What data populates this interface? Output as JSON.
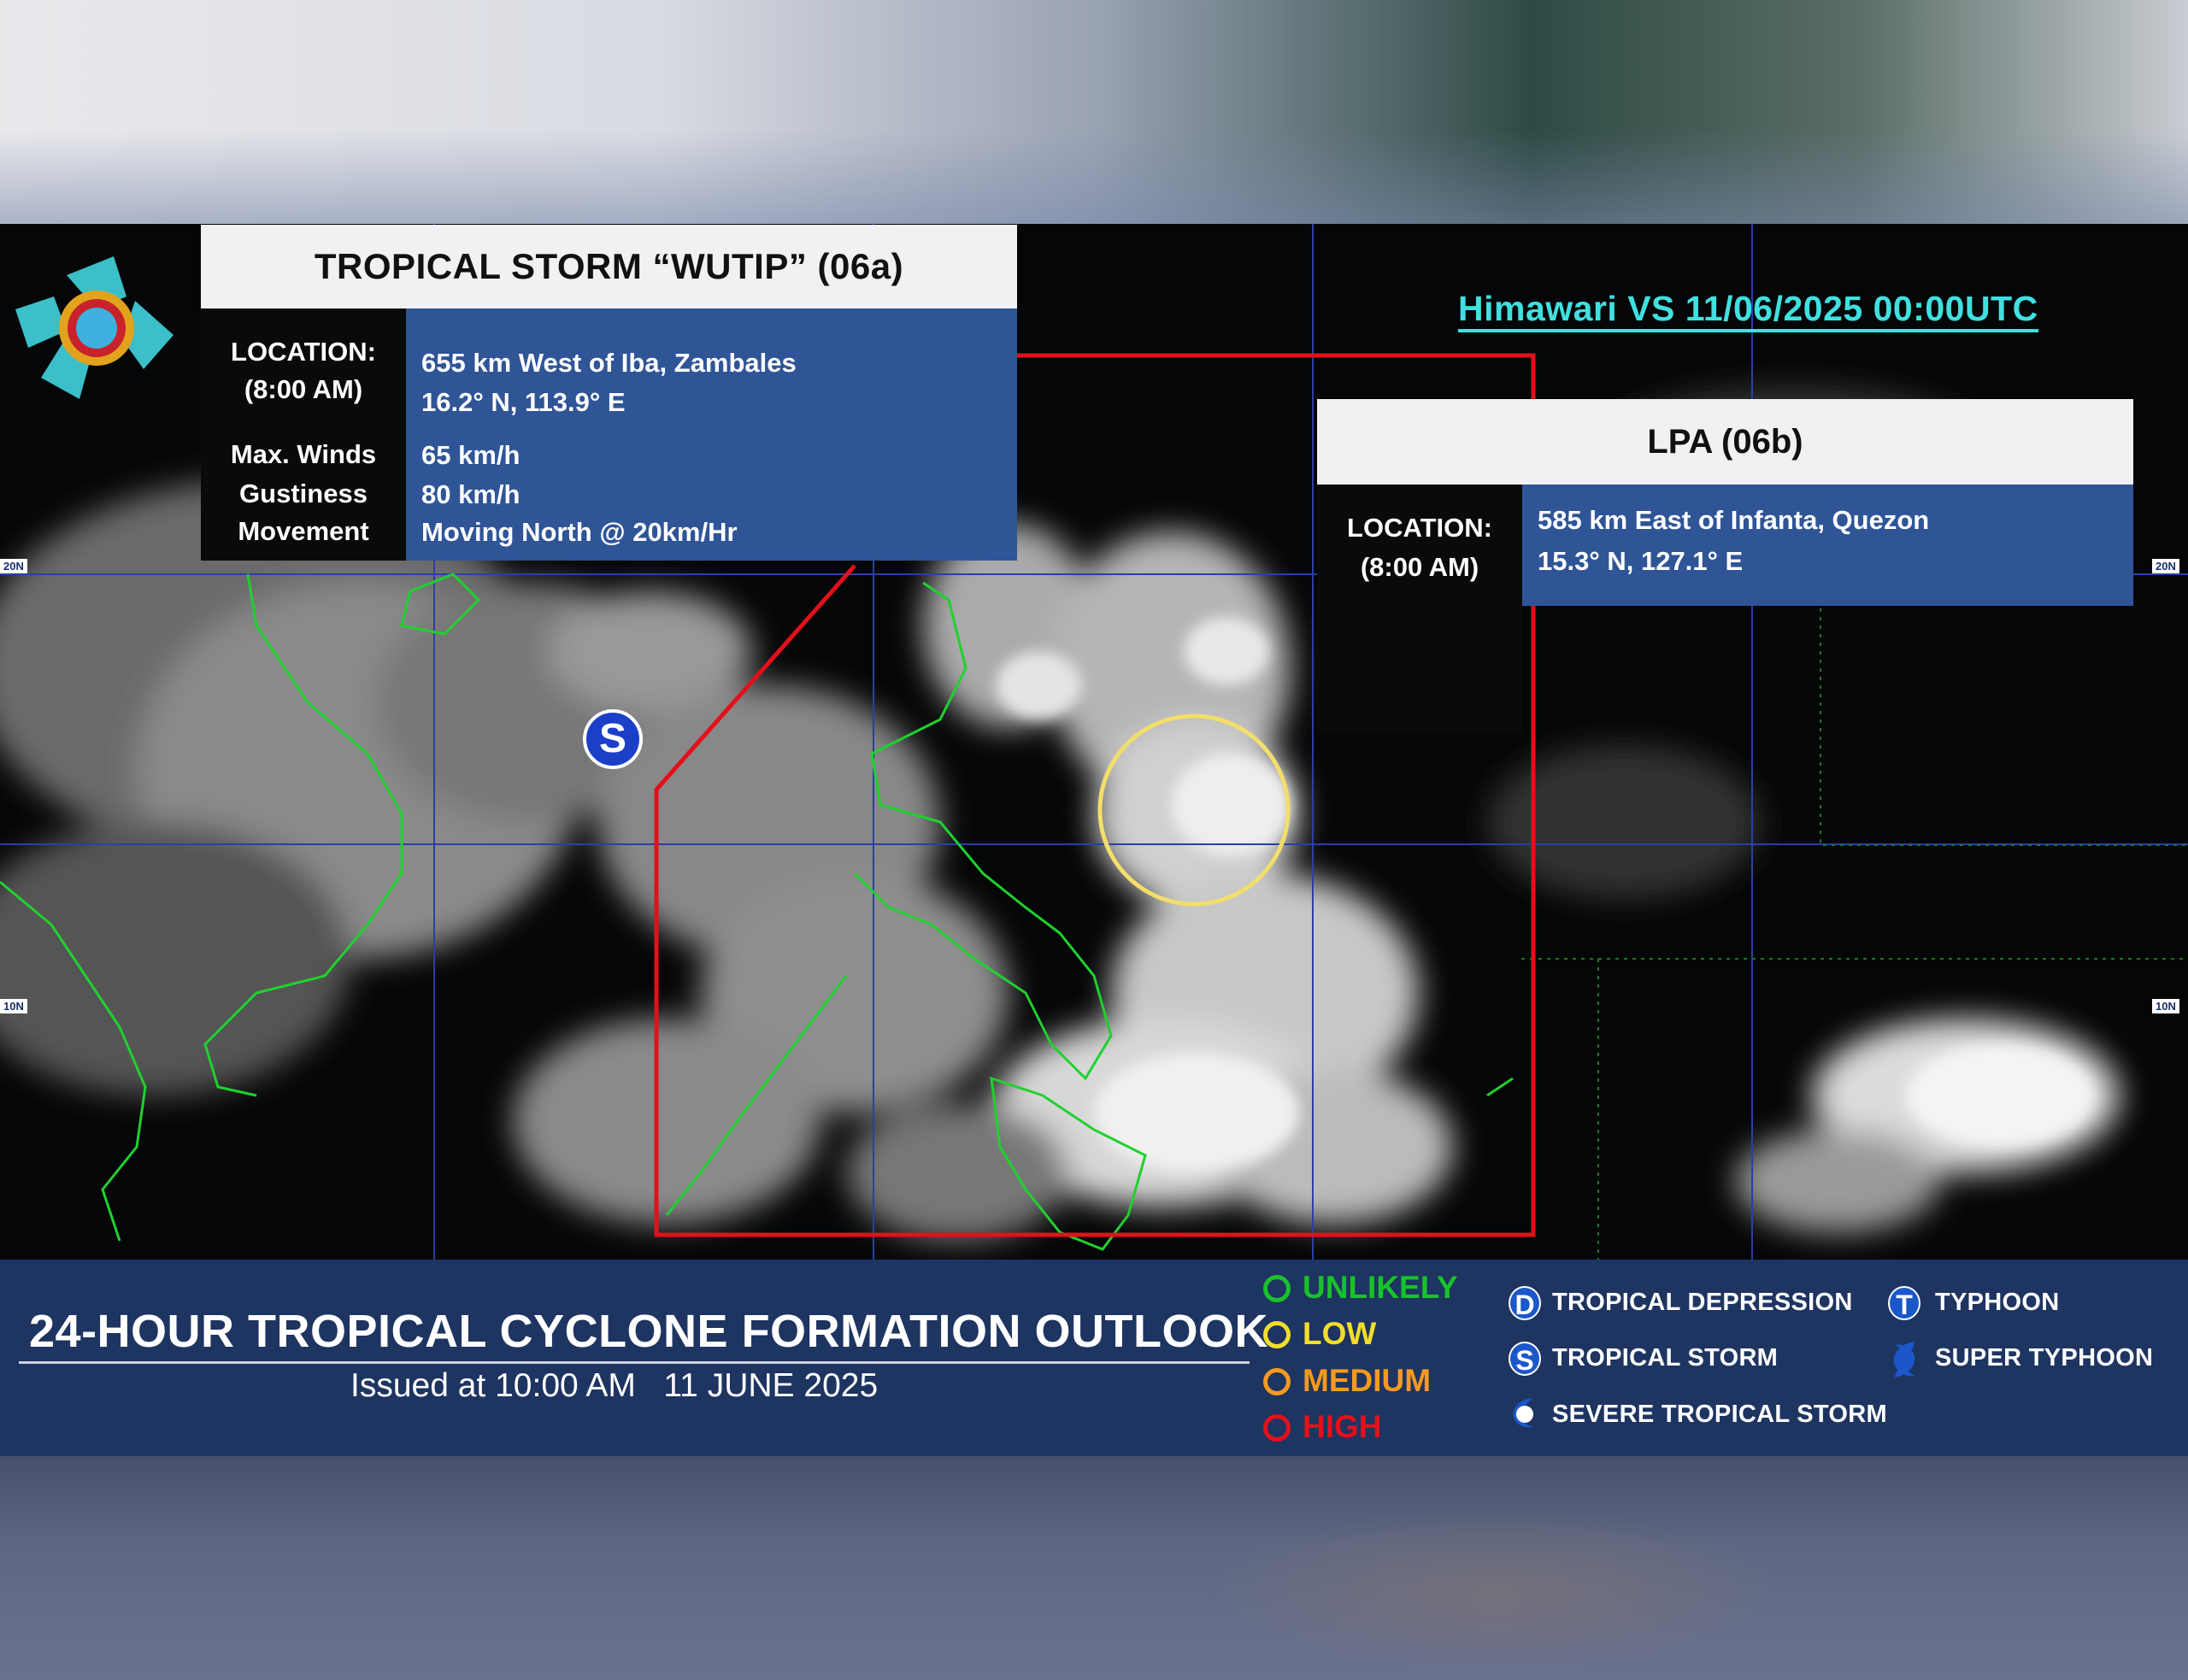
{
  "storm": {
    "title": "TROPICAL STORM “WUTIP” (06a)",
    "location_label": "LOCATION:",
    "time_label": "(8:00 AM)",
    "location": "655 km West of Iba, Zambales",
    "coords": "16.2° N, 113.9° E",
    "max_winds_label": "Max. Winds",
    "max_winds": "65 km/h",
    "gustiness_label": "Gustiness",
    "gustiness": "80 km/h",
    "movement_label": "Movement",
    "movement": "Moving  North @ 20km/Hr",
    "marker": "S"
  },
  "lpa": {
    "title": "LPA (06b)",
    "location_label": "LOCATION:",
    "time_label": "(8:00 AM)",
    "location": "585 km East of Infanta, Quezon",
    "coords": "15.3° N, 127.1° E"
  },
  "imagery_label": "Himawari VS 11/06/2025 00:00UTC",
  "lat_labels": {
    "l20": "20N",
    "l10": "10N"
  },
  "footer": {
    "title": "24-HOUR TROPICAL CYCLONE FORMATION OUTLOOK",
    "issued": "Issued at 10:00 AM   11 JUNE 2025",
    "likelihood": [
      {
        "label": "UNLIKELY",
        "color": "#19c12b"
      },
      {
        "label": "LOW",
        "color": "#f2de2a"
      },
      {
        "label": "MEDIUM",
        "color": "#f59a1e"
      },
      {
        "label": "HIGH",
        "color": "#e3101b"
      }
    ],
    "categories": {
      "td_symbol": "D",
      "td": "TROPICAL DEPRESSION",
      "ts_symbol": "S",
      "ts": "TROPICAL STORM",
      "sts": "SEVERE TROPICAL STORM",
      "ty_symbol": "T",
      "ty": "TYPHOON",
      "sty": "SUPER TYPHOON"
    }
  },
  "colors": {
    "par_boundary": "#e3101b",
    "lpa_circle": "#f2de6a",
    "coastline": "#1fd12f",
    "grid": "#2a3fa8"
  },
  "icons": [
    "pagasa-logo",
    "tropical-storm-marker-icon",
    "lpa-circle",
    "td-icon",
    "ts-icon",
    "sts-icon",
    "typhoon-icon",
    "super-typhoon-icon"
  ]
}
